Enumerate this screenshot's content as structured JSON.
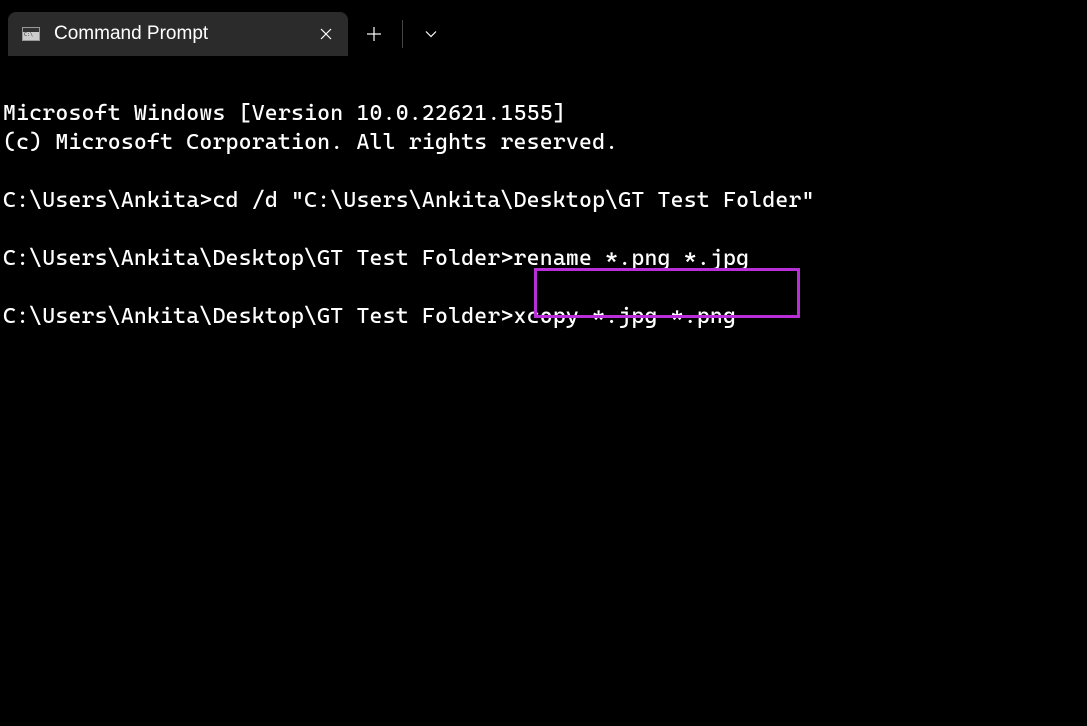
{
  "tab": {
    "title": "Command Prompt"
  },
  "terminal": {
    "line1": "Microsoft Windows [Version 10.0.22621.1555]",
    "line2": "(c) Microsoft Corporation. All rights reserved.",
    "line3": "",
    "line4_prompt": "C:\\Users\\Ankita>",
    "line4_cmd": "cd /d \"C:\\Users\\Ankita\\Desktop\\GT Test Folder\"",
    "line5": "",
    "line6_prompt": "C:\\Users\\Ankita\\Desktop\\GT Test Folder>",
    "line6_cmd": "rename *.png *.jpg",
    "line7": "",
    "line8_prompt": "C:\\Users\\Ankita\\Desktop\\GT Test Folder>",
    "line8_cmd": "xcopy *.jpg *.png"
  },
  "highlight": {
    "color": "#b82fd8"
  }
}
